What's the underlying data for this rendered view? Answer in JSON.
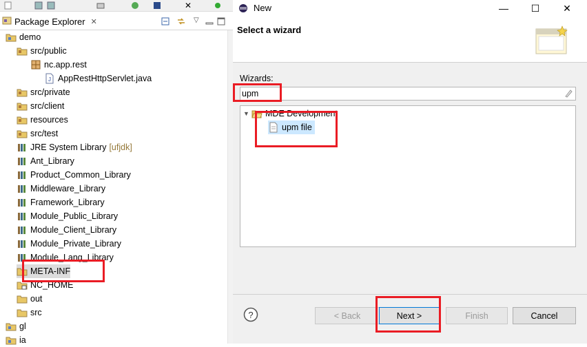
{
  "package_explorer": {
    "title": "Package Explorer",
    "items": [
      {
        "label": "demo",
        "decoration": "",
        "indent": 0,
        "icon": "project-icon",
        "expanded": true,
        "selected": false
      },
      {
        "label": "src/public",
        "decoration": "",
        "indent": 1,
        "icon": "source-folder-icon",
        "expanded": true,
        "selected": false
      },
      {
        "label": "nc.app.rest",
        "decoration": "",
        "indent": 2,
        "icon": "package-icon",
        "expanded": true,
        "selected": false
      },
      {
        "label": "AppRestHttpServlet.java",
        "decoration": "",
        "indent": 3,
        "icon": "java-file-icon",
        "expanded": false,
        "selected": false
      },
      {
        "label": "src/private",
        "decoration": "",
        "indent": 1,
        "icon": "source-folder-icon",
        "expanded": false,
        "selected": false
      },
      {
        "label": "src/client",
        "decoration": "",
        "indent": 1,
        "icon": "source-folder-icon",
        "expanded": false,
        "selected": false
      },
      {
        "label": "resources",
        "decoration": "",
        "indent": 1,
        "icon": "source-folder-icon",
        "expanded": false,
        "selected": false
      },
      {
        "label": "src/test",
        "decoration": "",
        "indent": 1,
        "icon": "source-folder-icon",
        "expanded": false,
        "selected": false
      },
      {
        "label": "JRE System Library",
        "decoration": "[ufjdk]",
        "indent": 1,
        "icon": "library-icon",
        "expanded": false,
        "selected": false
      },
      {
        "label": "Ant_Library",
        "decoration": "",
        "indent": 1,
        "icon": "library-icon",
        "expanded": false,
        "selected": false
      },
      {
        "label": "Product_Common_Library",
        "decoration": "",
        "indent": 1,
        "icon": "library-icon",
        "expanded": false,
        "selected": false
      },
      {
        "label": "Middleware_Library",
        "decoration": "",
        "indent": 1,
        "icon": "library-icon",
        "expanded": false,
        "selected": false
      },
      {
        "label": "Framework_Library",
        "decoration": "",
        "indent": 1,
        "icon": "library-icon",
        "expanded": false,
        "selected": false
      },
      {
        "label": "Module_Public_Library",
        "decoration": "",
        "indent": 1,
        "icon": "library-icon",
        "expanded": false,
        "selected": false
      },
      {
        "label": "Module_Client_Library",
        "decoration": "",
        "indent": 1,
        "icon": "library-icon",
        "expanded": false,
        "selected": false
      },
      {
        "label": "Module_Private_Library",
        "decoration": "",
        "indent": 1,
        "icon": "library-icon",
        "expanded": false,
        "selected": false
      },
      {
        "label": "Module_Lang_Library",
        "decoration": "",
        "indent": 1,
        "icon": "library-icon",
        "expanded": false,
        "selected": false
      },
      {
        "label": "META-INF",
        "decoration": "",
        "indent": 1,
        "icon": "folder-icon",
        "expanded": false,
        "selected": true
      },
      {
        "label": "NC_HOME",
        "decoration": "",
        "indent": 1,
        "icon": "linked-folder-icon",
        "expanded": false,
        "selected": false
      },
      {
        "label": "out",
        "decoration": "",
        "indent": 1,
        "icon": "folder-icon",
        "expanded": false,
        "selected": false
      },
      {
        "label": "src",
        "decoration": "",
        "indent": 1,
        "icon": "folder-icon",
        "expanded": false,
        "selected": false
      },
      {
        "label": "gl",
        "decoration": "",
        "indent": 0,
        "icon": "project-icon",
        "expanded": false,
        "selected": false
      },
      {
        "label": "ia",
        "decoration": "",
        "indent": 0,
        "icon": "project-icon",
        "expanded": false,
        "selected": false
      }
    ]
  },
  "dialog": {
    "title": "New",
    "header_title": "Select a wizard",
    "wizards_label": "Wizards:",
    "filter_value": "upm",
    "tree": [
      {
        "label": "MDE Development",
        "indent": 0,
        "icon": "folder-open-icon",
        "expanded": true,
        "selected": false
      },
      {
        "label": "upm file",
        "indent": 1,
        "icon": "file-icon",
        "expanded": false,
        "selected": true
      }
    ],
    "buttons": {
      "back": "< Back",
      "next": "Next >",
      "finish": "Finish",
      "cancel": "Cancel"
    }
  },
  "colors": {
    "highlight_red": "#ea1c24",
    "selection_blue": "#cce8ff",
    "library_decoration": "#95793a"
  }
}
